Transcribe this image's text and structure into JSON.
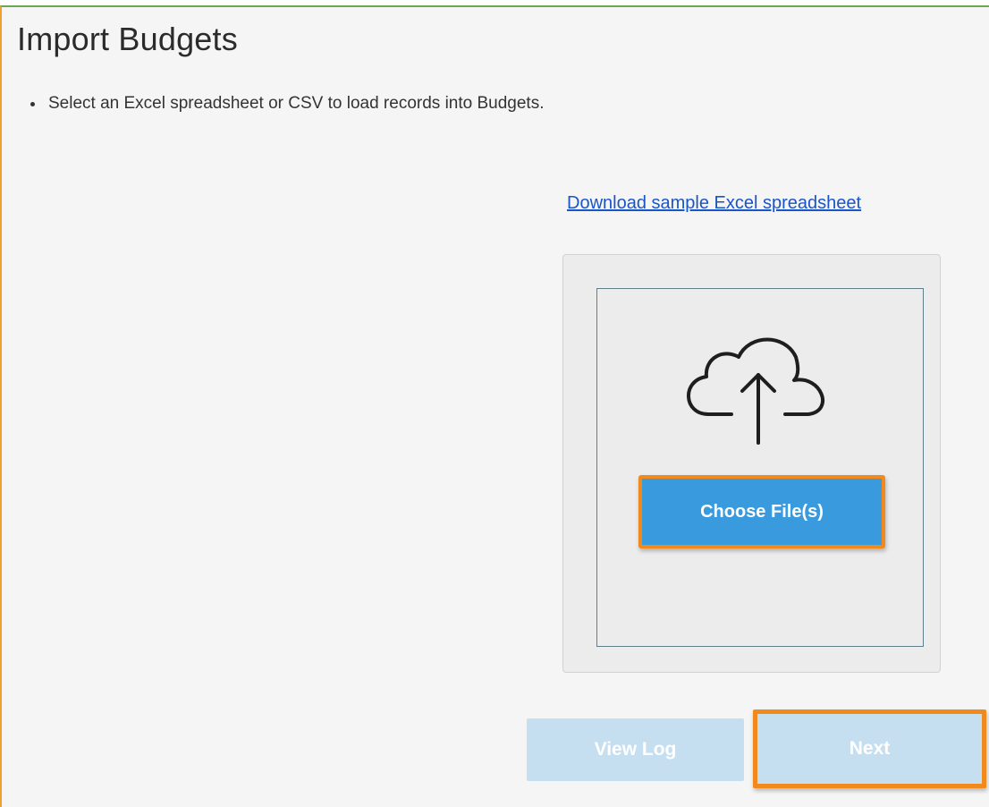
{
  "dialog": {
    "title": "Import Budgets",
    "instructions": [
      "Select an Excel spreadsheet or CSV to load records into Budgets."
    ],
    "sample_link_label": "Download sample Excel spreadsheet"
  },
  "upload": {
    "icon": "cloud-upload-icon",
    "choose_button_label": "Choose File(s)"
  },
  "footer": {
    "view_log_label": "View Log",
    "next_label": "Next"
  },
  "colors": {
    "accent_blue": "#3a9ade",
    "disabled_blue": "#c6dff0",
    "highlight_orange": "#f08a1d",
    "link_blue": "#1a55c7",
    "panel_background": "#f5f5f5"
  }
}
